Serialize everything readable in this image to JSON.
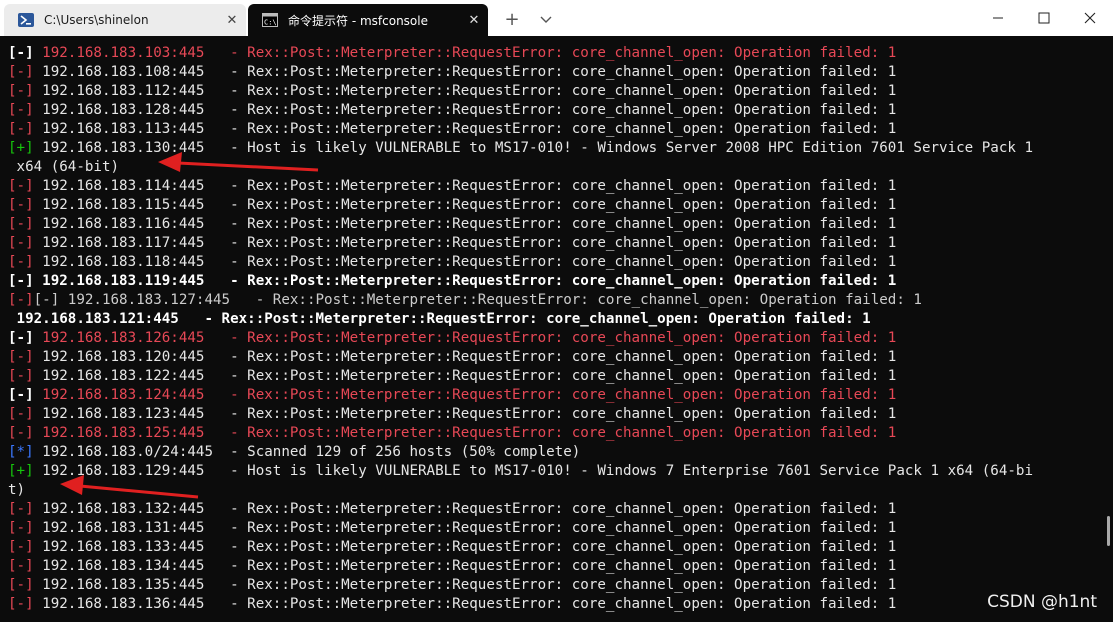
{
  "tabs": [
    {
      "title": "C:\\Users\\shinelon",
      "active": false
    },
    {
      "title": "命令提示符 - msfconsole",
      "active": true
    }
  ],
  "tab_close_glyph": "✕",
  "new_tab_glyph": "+",
  "window_buttons": [
    "minimize",
    "maximize",
    "close"
  ],
  "terminal": {
    "lines": [
      [
        {
          "t": "[-]",
          "c": "wb"
        },
        {
          "t": " 192.168.183.103:445   - Rex::Post::Meterpreter::RequestError: core_channel_open: Operation failed: 1",
          "c": "r"
        }
      ],
      [
        {
          "t": "[-]",
          "c": "r"
        },
        {
          "t": " 192.168.183.108:445   - Rex::Post::Meterpreter::RequestError: core_channel_open: Operation failed: 1",
          "c": "w"
        }
      ],
      [
        {
          "t": "[-]",
          "c": "r"
        },
        {
          "t": " 192.168.183.112:445   - Rex::Post::Meterpreter::RequestError: core_channel_open: Operation failed: 1",
          "c": "w"
        }
      ],
      [
        {
          "t": "[-]",
          "c": "r"
        },
        {
          "t": " 192.168.183.128:445   - Rex::Post::Meterpreter::RequestError: core_channel_open: Operation failed: 1",
          "c": "w"
        }
      ],
      [
        {
          "t": "[-]",
          "c": "r"
        },
        {
          "t": " 192.168.183.113:445   - Rex::Post::Meterpreter::RequestError: core_channel_open: Operation failed: 1",
          "c": "w"
        }
      ],
      [
        {
          "t": "[+]",
          "c": "g"
        },
        {
          "t": " 192.168.183.130:445   - Host is likely VULNERABLE to MS17-010! - Windows Server 2008 HPC Edition 7601 Service Pack 1",
          "c": "w"
        }
      ],
      [
        {
          "t": " x64 (64-bit)",
          "c": "w"
        }
      ],
      [
        {
          "t": "[-]",
          "c": "r"
        },
        {
          "t": " 192.168.183.114:445   - Rex::Post::Meterpreter::RequestError: core_channel_open: Operation failed: 1",
          "c": "w"
        }
      ],
      [
        {
          "t": "[-]",
          "c": "r"
        },
        {
          "t": " 192.168.183.115:445   - Rex::Post::Meterpreter::RequestError: core_channel_open: Operation failed: 1",
          "c": "w"
        }
      ],
      [
        {
          "t": "[-]",
          "c": "r"
        },
        {
          "t": " 192.168.183.116:445   - Rex::Post::Meterpreter::RequestError: core_channel_open: Operation failed: 1",
          "c": "w"
        }
      ],
      [
        {
          "t": "[-]",
          "c": "r"
        },
        {
          "t": " 192.168.183.117:445   - Rex::Post::Meterpreter::RequestError: core_channel_open: Operation failed: 1",
          "c": "w"
        }
      ],
      [
        {
          "t": "[-]",
          "c": "r"
        },
        {
          "t": " 192.168.183.118:445   - Rex::Post::Meterpreter::RequestError: core_channel_open: Operation failed: 1",
          "c": "w"
        }
      ],
      [
        {
          "t": "[-]",
          "c": "wb"
        },
        {
          "t": " 192.168.183.119:445   - Rex::Post::Meterpreter::RequestError: core_channel_open: Operation failed: 1",
          "c": "wb"
        }
      ],
      [
        {
          "t": "[-]",
          "c": "r"
        },
        {
          "t": "[-] 192.168.183.127:445   - Rex::Post::Meterpreter::RequestError: core_channel_open: Operation failed: 1",
          "c": "dim"
        }
      ],
      [
        {
          "t": " 192.168.183.121:445   - Rex::Post::Meterpreter::RequestError: core_channel_open: Operation failed: 1",
          "c": "wb"
        }
      ],
      [
        {
          "t": "[-]",
          "c": "wb"
        },
        {
          "t": " 192.168.183.126:445   - Rex::Post::Meterpreter::RequestError: core_channel_open: Operation failed: 1",
          "c": "r"
        }
      ],
      [
        {
          "t": "[-]",
          "c": "r"
        },
        {
          "t": " 192.168.183.120:445   - Rex::Post::Meterpreter::RequestError: core_channel_open: Operation failed: 1",
          "c": "w"
        }
      ],
      [
        {
          "t": "[-]",
          "c": "r"
        },
        {
          "t": " 192.168.183.122:445   - Rex::Post::Meterpreter::RequestError: core_channel_open: Operation failed: 1",
          "c": "w"
        }
      ],
      [
        {
          "t": "[-]",
          "c": "wb"
        },
        {
          "t": " 192.168.183.124:445   - Rex::Post::Meterpreter::RequestError: core_channel_open: Operation failed: 1",
          "c": "r"
        }
      ],
      [
        {
          "t": "[-]",
          "c": "r"
        },
        {
          "t": " 192.168.183.123:445   - Rex::Post::Meterpreter::RequestError: core_channel_open: Operation failed: 1",
          "c": "w"
        }
      ],
      [
        {
          "t": "[-]",
          "c": "r"
        },
        {
          "t": " 192.168.183.125:445   - Rex::Post::Meterpreter::RequestError: core_channel_open: Operation failed: 1",
          "c": "r"
        }
      ],
      [
        {
          "t": "[*]",
          "c": "b"
        },
        {
          "t": " 192.168.183.0/24:445  - Scanned 129 of 256 hosts (50% complete)",
          "c": "w"
        }
      ],
      [
        {
          "t": "[+]",
          "c": "g"
        },
        {
          "t": " 192.168.183.129:445   - Host is likely VULNERABLE to MS17-010! - Windows 7 Enterprise 7601 Service Pack 1 x64 (64-bi",
          "c": "w"
        }
      ],
      [
        {
          "t": "t)",
          "c": "w"
        }
      ],
      [
        {
          "t": "[-]",
          "c": "r"
        },
        {
          "t": " 192.168.183.132:445   - Rex::Post::Meterpreter::RequestError: core_channel_open: Operation failed: 1",
          "c": "w"
        }
      ],
      [
        {
          "t": "[-]",
          "c": "r"
        },
        {
          "t": " 192.168.183.131:445   - Rex::Post::Meterpreter::RequestError: core_channel_open: Operation failed: 1",
          "c": "w"
        }
      ],
      [
        {
          "t": "[-]",
          "c": "r"
        },
        {
          "t": " 192.168.183.133:445   - Rex::Post::Meterpreter::RequestError: core_channel_open: Operation failed: 1",
          "c": "w"
        }
      ],
      [
        {
          "t": "[-]",
          "c": "r"
        },
        {
          "t": " 192.168.183.134:445   - Rex::Post::Meterpreter::RequestError: core_channel_open: Operation failed: 1",
          "c": "w"
        }
      ],
      [
        {
          "t": "[-]",
          "c": "r"
        },
        {
          "t": " 192.168.183.135:445   - Rex::Post::Meterpreter::RequestError: core_channel_open: Operation failed: 1",
          "c": "w"
        }
      ],
      [
        {
          "t": "[-]",
          "c": "r"
        },
        {
          "t": " 192.168.183.136:445   - Rex::Post::Meterpreter::RequestError: core_channel_open: Operation failed: 1",
          "c": "w"
        }
      ]
    ]
  },
  "annotation_color": "#e02020",
  "watermark": "CSDN @h1nt"
}
